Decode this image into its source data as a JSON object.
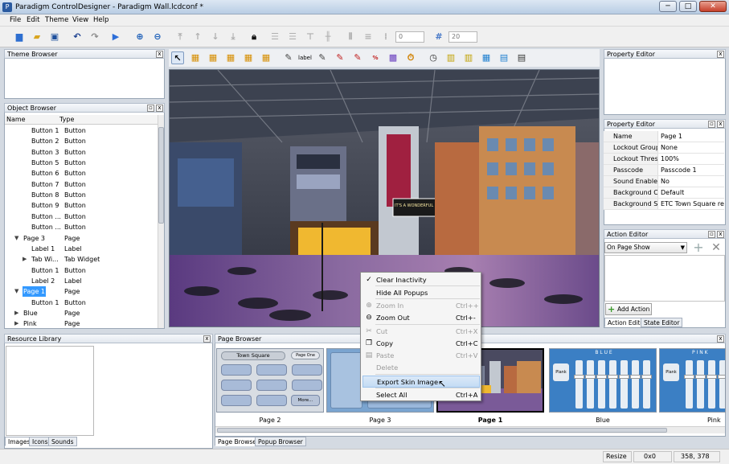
{
  "window": {
    "title": "Paradigm ControlDesigner - Paradigm Wall.lcdconf *",
    "minimize": "─",
    "maximize": "□",
    "close": "✕"
  },
  "menubar": [
    "File",
    "Edit",
    "Theme",
    "View",
    "Help"
  ],
  "toolbar": {
    "zoom_spin": "0",
    "grid_spin": "20"
  },
  "theme_browser": {
    "title": "Theme Browser"
  },
  "object_browser": {
    "title": "Object Browser",
    "columns": [
      "Name",
      "Type"
    ],
    "rows": [
      {
        "name": "Button 1",
        "type": "Button",
        "indent": 2
      },
      {
        "name": "Button 2",
        "type": "Button",
        "indent": 2
      },
      {
        "name": "Button 3",
        "type": "Button",
        "indent": 2
      },
      {
        "name": "Button 5",
        "type": "Button",
        "indent": 2
      },
      {
        "name": "Button 6",
        "type": "Button",
        "indent": 2
      },
      {
        "name": "Button 7",
        "type": "Button",
        "indent": 2
      },
      {
        "name": "Button 8",
        "type": "Button",
        "indent": 2
      },
      {
        "name": "Button 9",
        "type": "Button",
        "indent": 2
      },
      {
        "name": "Button ...",
        "type": "Button",
        "indent": 2
      },
      {
        "name": "Button ...",
        "type": "Button",
        "indent": 2
      },
      {
        "name": "Page 3",
        "type": "Page",
        "indent": 1,
        "expander": "▼"
      },
      {
        "name": "Label 1",
        "type": "Label",
        "indent": 2
      },
      {
        "name": "Tab Wi...",
        "type": "Tab Widget",
        "indent": 2,
        "expander": "▶"
      },
      {
        "name": "Button 1",
        "type": "Button",
        "indent": 2
      },
      {
        "name": "Label 2",
        "type": "Label",
        "indent": 2
      },
      {
        "name": "Page 1",
        "type": "Page",
        "indent": 1,
        "expander": "▼",
        "selected": true
      },
      {
        "name": "Button 1",
        "type": "Button",
        "indent": 2
      },
      {
        "name": "Blue",
        "type": "Page",
        "indent": 1,
        "expander": "▶"
      },
      {
        "name": "Pink",
        "type": "Page",
        "indent": 1,
        "expander": "▶"
      }
    ]
  },
  "resource_library": {
    "title": "Resource Library",
    "tabs": [
      "Images",
      "Icons",
      "Sounds"
    ]
  },
  "property_editor_top": {
    "title": "Property Editor"
  },
  "property_editor": {
    "title": "Property Editor",
    "rows": [
      {
        "key": "Name",
        "value": "Page 1"
      },
      {
        "key": "Lockout Group",
        "value": "None"
      },
      {
        "key": "Lockout Thres...",
        "value": "100%"
      },
      {
        "key": "Passcode",
        "value": "Passcode 1"
      },
      {
        "key": "Sound Enabled",
        "value": "No"
      },
      {
        "key": "Background C...",
        "value": "Default"
      },
      {
        "key": "Background Skin",
        "value": "ETC Town Square red..."
      }
    ]
  },
  "action_editor": {
    "title": "Action Editor",
    "dropdown": "On Page Show",
    "add_action": "Add Action",
    "tabs": [
      "Action Editor",
      "State Editor"
    ]
  },
  "page_browser": {
    "title": "Page Browser",
    "pages": [
      "Page 2",
      "Page 3",
      "Page 1",
      "Blue",
      "Pink"
    ],
    "page2_title": "Town Square",
    "page2_btn": "Page One",
    "page2_more": "More...",
    "blue_header": "B L U E",
    "blue_btn": "Plank",
    "pink_header": "P I N K",
    "pink_btn": "Plank",
    "tabs": [
      "Page Browser",
      "Popup Browser"
    ]
  },
  "context_menu": {
    "items": [
      {
        "label": "Clear Inactivity",
        "shortcut": "",
        "icon": "✓",
        "disabled": false
      },
      {
        "label": "Hide All Popups",
        "shortcut": "",
        "disabled": false
      },
      {
        "label": "Zoom In",
        "shortcut": "Ctrl++",
        "icon": "⊕",
        "disabled": true
      },
      {
        "label": "Zoom Out",
        "shortcut": "Ctrl+-",
        "icon": "⊖",
        "disabled": false
      },
      {
        "label": "Cut",
        "shortcut": "Ctrl+X",
        "icon": "✂",
        "disabled": true
      },
      {
        "label": "Copy",
        "shortcut": "Ctrl+C",
        "icon": "❐",
        "disabled": false
      },
      {
        "label": "Paste",
        "shortcut": "Ctrl+V",
        "icon": "▤",
        "disabled": true
      },
      {
        "label": "Delete",
        "shortcut": "",
        "disabled": true
      },
      {
        "label": "Export Skin Image",
        "shortcut": "",
        "disabled": false,
        "highlight": true
      },
      {
        "label": "Select All",
        "shortcut": "Ctrl+A",
        "disabled": false
      }
    ]
  },
  "canvas_sign": {
    "sign1": "IT'S A WONDERFUL LIFE"
  },
  "statusbar": {
    "mode": "Resize",
    "size": "0x0",
    "coords": "358, 378"
  }
}
